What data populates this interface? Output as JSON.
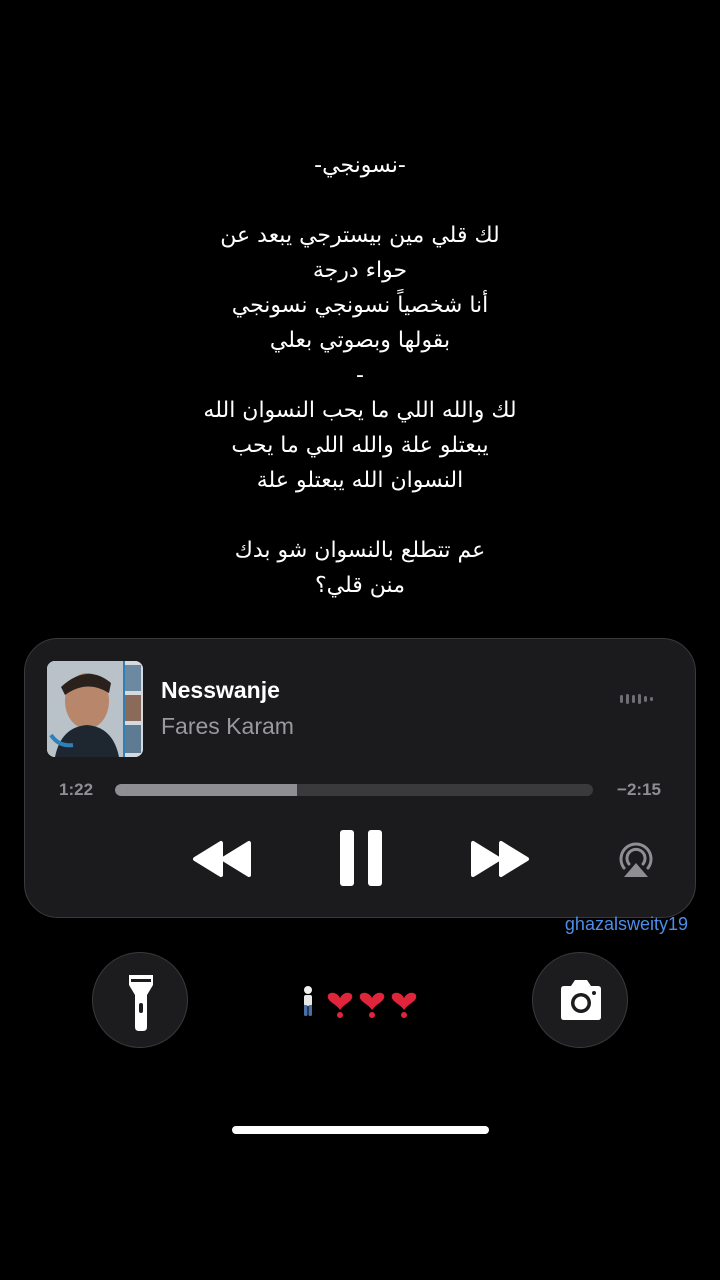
{
  "lyrics": [
    "-نسونجي-",
    "",
    "لك قلي مين بيسترجي يبعد عن",
    "حواء درجة",
    "أنا شخصياً نسونجي نسونجي",
    "بقولها وبصوتي بعلي",
    "-",
    "لك والله اللي ما يحب النسوان الله",
    "يبعتلو علة والله اللي ما يحب",
    "النسوان الله يبعتلو علة",
    "",
    "عم تتطلع بالنسوان شو بدك",
    "منن قلي؟"
  ],
  "player": {
    "title": "Nesswanje",
    "artist": "Fares Karam",
    "elapsed": "1:22",
    "remaining": "−2:15",
    "progress": 0.38
  },
  "watermark": "ghazalsweity19",
  "icons": {
    "flashlight": "flashlight-icon",
    "camera": "camera-icon",
    "rewind": "rewind-icon",
    "pause": "pause-icon",
    "forward": "fast-forward-icon",
    "airplay": "airplay-icon",
    "waveform": "waveform-icon",
    "person": "person-emoji",
    "hearts": "heart-exclamation-emoji"
  },
  "colors": {
    "background": "#000000",
    "player": "#1b1b1d",
    "watermark": "#4c8ee8",
    "heart": "#e0243a"
  }
}
